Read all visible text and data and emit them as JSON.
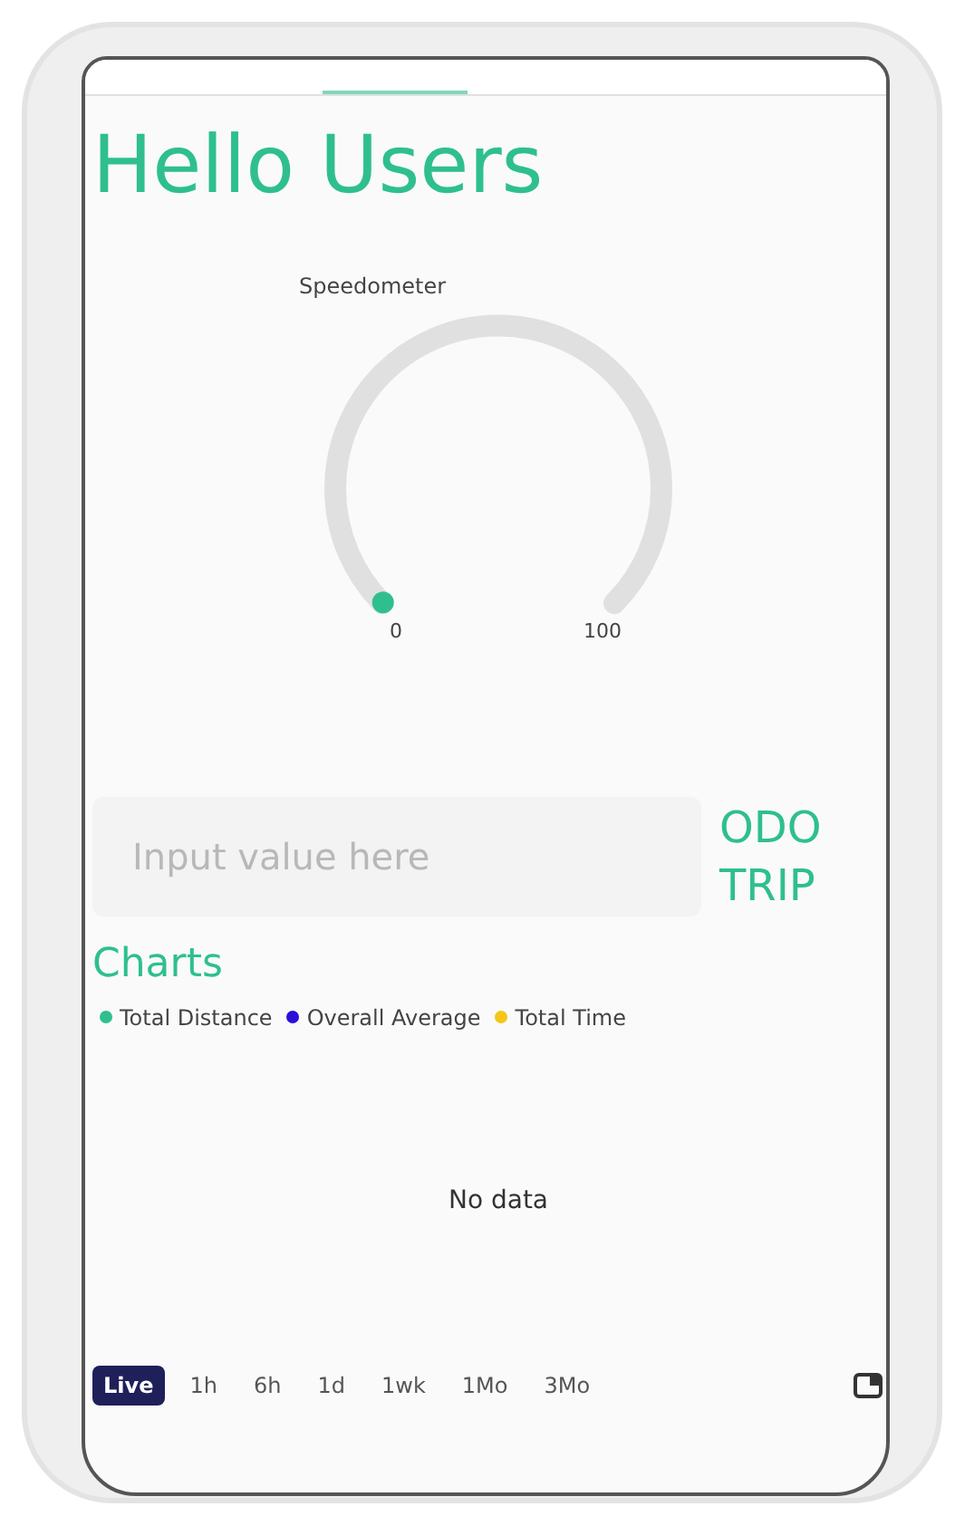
{
  "heading": "Hello Users",
  "gauge": {
    "title": "Speedometer",
    "min_label": "0",
    "max_label": "100"
  },
  "input": {
    "placeholder": "Input value here"
  },
  "modes": [
    "ODO",
    "TRIP"
  ],
  "charts": {
    "title": "Charts",
    "legend": [
      {
        "label": "Total Distance",
        "color": "#2fbf8f"
      },
      {
        "label": "Overall Average",
        "color": "#2a10d8"
      },
      {
        "label": "Total Time",
        "color": "#f5c518"
      }
    ],
    "empty_text": "No data"
  },
  "ranges": [
    {
      "label": "Live",
      "selected": true
    },
    {
      "label": "1h",
      "selected": false
    },
    {
      "label": "6h",
      "selected": false
    },
    {
      "label": "1d",
      "selected": false
    },
    {
      "label": "1wk",
      "selected": false
    },
    {
      "label": "1Mo",
      "selected": false
    },
    {
      "label": "3Mo",
      "selected": false
    }
  ]
}
